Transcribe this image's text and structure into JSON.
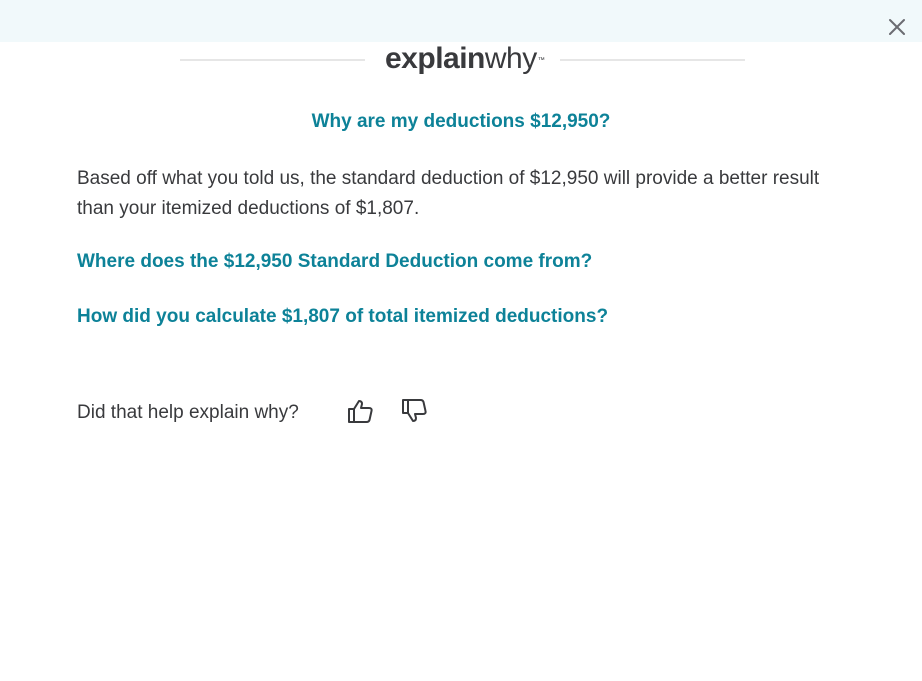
{
  "modal": {
    "brand_bold": "explain",
    "brand_light": "why",
    "brand_tm": "™",
    "question": "Why are my deductions $12,950?",
    "answer": "Based off what you told us, the standard deduction of $12,950 will provide a better result than your itemized deductions of $1,807.",
    "links": [
      "Where does the $12,950 Standard Deduction come from?",
      "How did you calculate $1,807 of total itemized deductions?"
    ],
    "feedback_prompt": "Did that help explain why?"
  },
  "icons": {
    "close": "close-icon",
    "thumbs_up": "thumbs-up-icon",
    "thumbs_down": "thumbs-down-icon"
  },
  "colors": {
    "topbar_bg": "#f1f9fb",
    "link_teal": "#0d8298",
    "text": "#393a3d"
  }
}
